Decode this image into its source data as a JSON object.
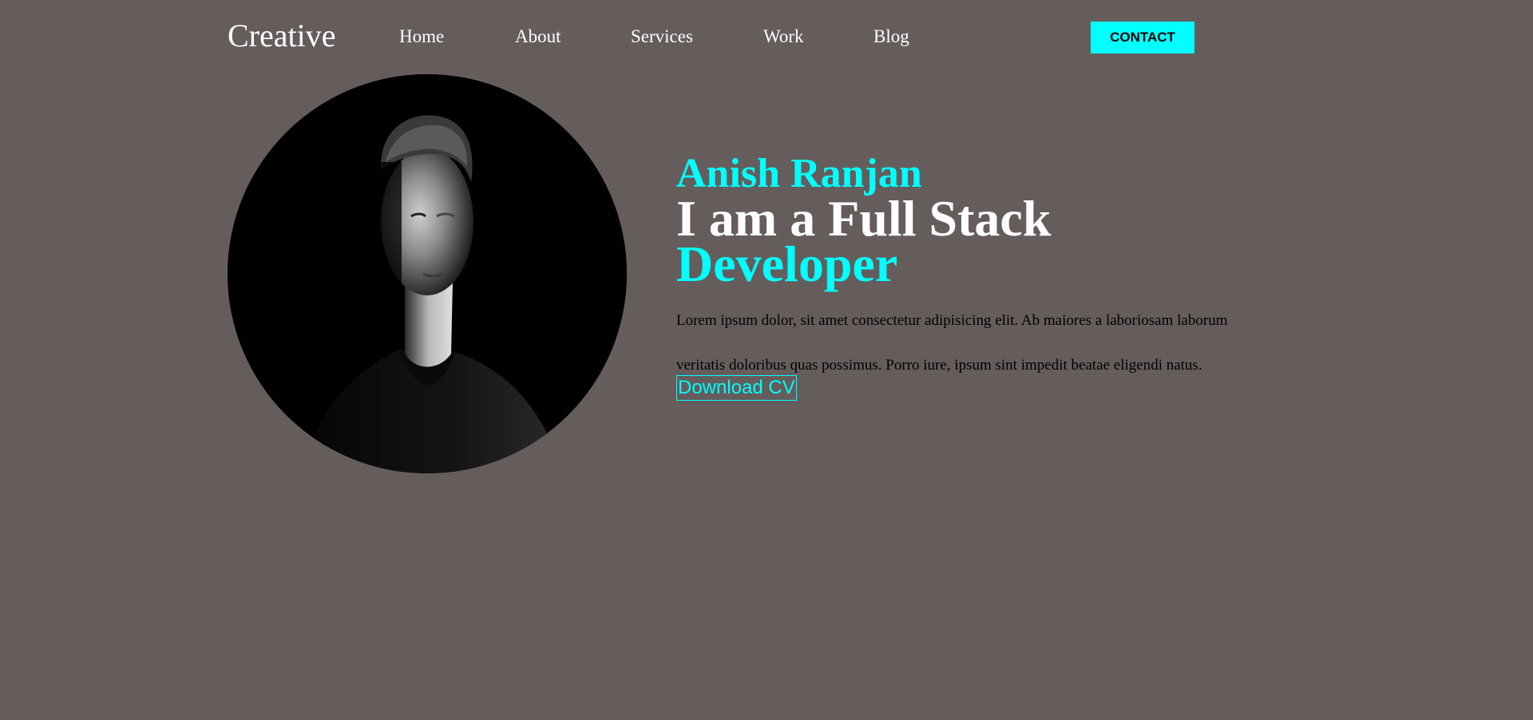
{
  "header": {
    "logo": "Creative",
    "nav": {
      "home": "Home",
      "about": "About",
      "services": "Services",
      "work": "Work",
      "blog": "Blog"
    },
    "contact_label": "CONTACT"
  },
  "hero": {
    "name": "Anish Ranjan",
    "line1": "I am a Full Stack",
    "line2": "Developer",
    "description_line1": "Lorem ipsum dolor, sit amet consectetur adipisicing elit. Ab maiores a laboriosam laborum",
    "description_line2": "veritatis doloribus quas possimus. Porro iure, ipsum sint impedit beatae eligendi natus.",
    "download_label": "Download CV"
  },
  "colors": {
    "background": "#655d5c",
    "accent": "#00ffff",
    "text": "#ffffff",
    "body_text": "#000000"
  }
}
